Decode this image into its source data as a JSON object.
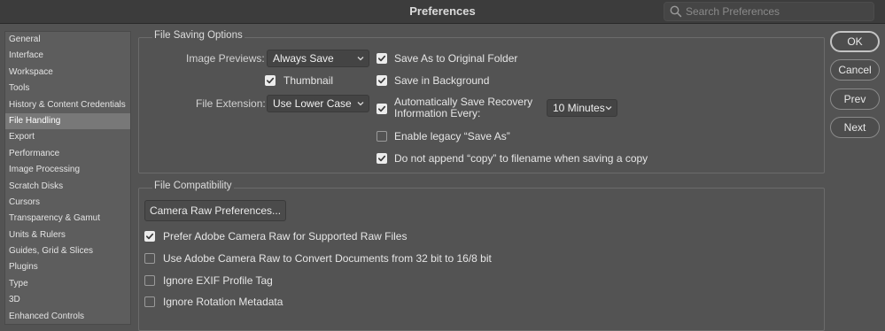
{
  "window": {
    "title": "Preferences"
  },
  "search": {
    "placeholder": "Search Preferences",
    "value": ""
  },
  "sidebar": {
    "items": [
      {
        "label": "General"
      },
      {
        "label": "Interface"
      },
      {
        "label": "Workspace"
      },
      {
        "label": "Tools"
      },
      {
        "label": "History & Content Credentials"
      },
      {
        "label": "File Handling",
        "selected": true
      },
      {
        "label": "Export"
      },
      {
        "label": "Performance"
      },
      {
        "label": "Image Processing"
      },
      {
        "label": "Scratch Disks"
      },
      {
        "label": "Cursors"
      },
      {
        "label": "Transparency & Gamut"
      },
      {
        "label": "Units & Rulers"
      },
      {
        "label": "Guides, Grid & Slices"
      },
      {
        "label": "Plugins"
      },
      {
        "label": "Type"
      },
      {
        "label": "3D"
      },
      {
        "label": "Enhanced Controls"
      }
    ]
  },
  "file_saving": {
    "title": "File Saving Options",
    "image_previews_label": "Image Previews:",
    "image_previews_value": "Always Save",
    "thumbnail_label": "Thumbnail",
    "thumbnail_checked": true,
    "file_extension_label": "File Extension:",
    "file_extension_value": "Use Lower Case",
    "save_as_original_label": "Save As to Original Folder",
    "save_as_original_checked": true,
    "save_background_label": "Save in Background",
    "save_background_checked": true,
    "auto_save_label_1": "Automatically Save Recovery",
    "auto_save_label_2": "Information Every:",
    "auto_save_checked": true,
    "auto_save_interval": "10 Minutes",
    "legacy_save_as_label": "Enable legacy “Save As”",
    "legacy_save_as_checked": false,
    "no_copy_label": "Do not append “copy” to filename when saving a copy",
    "no_copy_checked": true
  },
  "file_compat": {
    "title": "File Compatibility",
    "camera_raw_button": "Camera Raw Preferences...",
    "prefer_acr_label": "Prefer Adobe Camera Raw for Supported Raw Files",
    "prefer_acr_checked": true,
    "convert_32_label": "Use Adobe Camera Raw to Convert Documents from 32 bit to 16/8 bit",
    "convert_32_checked": false,
    "ignore_exif_label": "Ignore EXIF Profile Tag",
    "ignore_exif_checked": false,
    "ignore_rotation_label": "Ignore Rotation Metadata",
    "ignore_rotation_checked": false
  },
  "buttons": {
    "ok": "OK",
    "cancel": "Cancel",
    "prev": "Prev",
    "next": "Next"
  },
  "icons": {
    "search": "search-icon",
    "chevron": "chevron-down-icon",
    "check": "checkmark-icon"
  }
}
